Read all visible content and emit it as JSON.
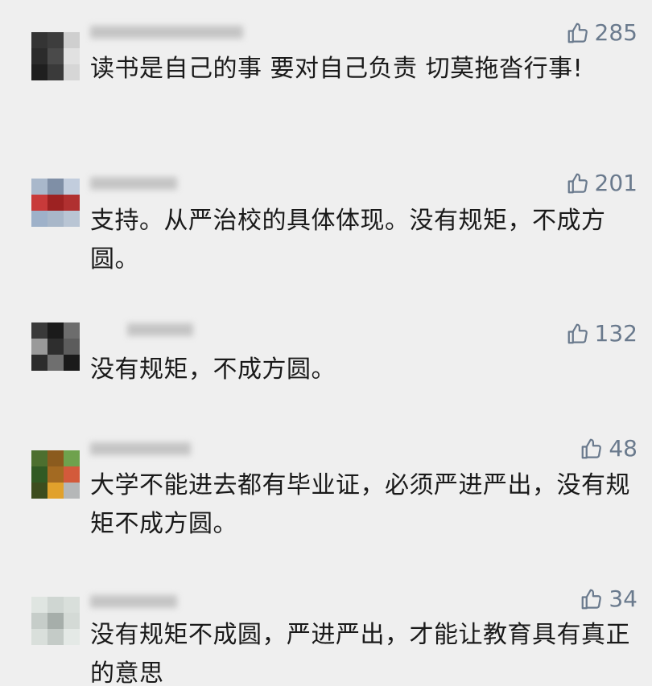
{
  "comments": [
    {
      "likes": "285",
      "text": "读书是自己的事 要对自己负责 切莫拖沓行事!"
    },
    {
      "likes": "201",
      "text": "支持。从严治校的具体体现。没有规矩，不成方圆。"
    },
    {
      "likes": "132",
      "text": "没有规矩，不成方圆。"
    },
    {
      "likes": "48",
      "text": "大学不能进去都有毕业证，必须严进严出，没有规矩不成方圆。"
    },
    {
      "likes": "34",
      "text": "没有规矩不成圆，严进严出，才能让教育具有真正的意思"
    }
  ],
  "icons": {
    "like": "thumbs-up-icon"
  },
  "colors": {
    "background": "#efefef",
    "like_count": "#6a7a8d",
    "text": "#1a1a1a"
  }
}
